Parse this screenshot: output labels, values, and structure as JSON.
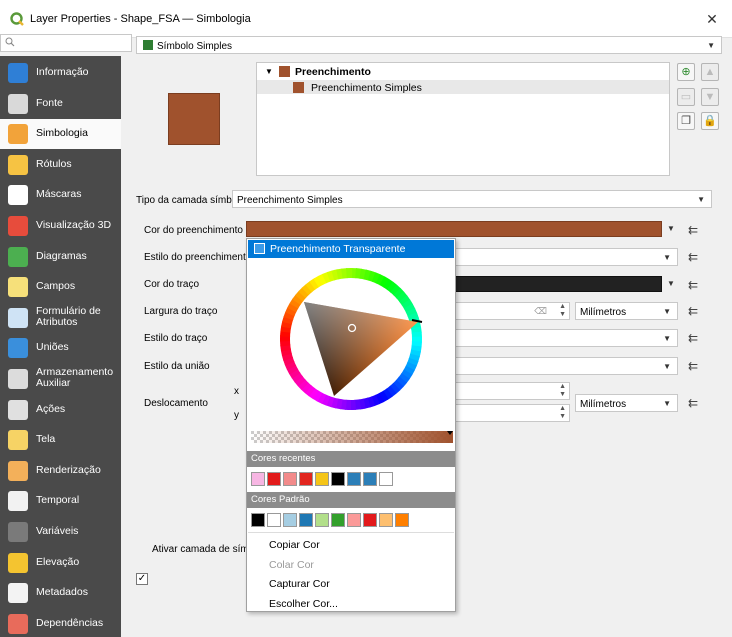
{
  "window": {
    "title": "Layer Properties - Shape_FSA — Simbologia",
    "close_glyph": "✕",
    "app_icon": "qgis-icon"
  },
  "search": {
    "placeholder": ""
  },
  "sidebar": {
    "items": [
      {
        "label": "Informação",
        "icon": "info-icon",
        "color": "#2f7fd6"
      },
      {
        "label": "Fonte",
        "icon": "source-icon",
        "color": "#d9d9d9"
      },
      {
        "label": "Simbologia",
        "icon": "symbology-icon",
        "color": "#f2a33a"
      },
      {
        "label": "Rótulos",
        "icon": "labels-icon",
        "color": "#f6c343"
      },
      {
        "label": "Máscaras",
        "icon": "masks-icon",
        "color": "#ffffff"
      },
      {
        "label": "Visualização 3D",
        "icon": "3d-view-icon",
        "color": "#e74c3c"
      },
      {
        "label": "Diagramas",
        "icon": "diagrams-icon",
        "color": "#4caf50"
      },
      {
        "label": "Campos",
        "icon": "fields-icon",
        "color": "#f6e07a"
      },
      {
        "label": "Formulário de Atributos",
        "icon": "attributes-form-icon",
        "color": "#cfe3f5"
      },
      {
        "label": "Uniões",
        "icon": "joins-icon",
        "color": "#3a8fdc"
      },
      {
        "label": "Armazenamento Auxiliar",
        "icon": "auxiliary-storage-icon",
        "color": "#dcdcdc"
      },
      {
        "label": "Ações",
        "icon": "actions-icon",
        "color": "#e0e0e0"
      },
      {
        "label": "Tela",
        "icon": "display-icon",
        "color": "#f6d365"
      },
      {
        "label": "Renderização",
        "icon": "rendering-icon",
        "color": "#f3b05a"
      },
      {
        "label": "Temporal",
        "icon": "temporal-icon",
        "color": "#f2f2f2"
      },
      {
        "label": "Variáveis",
        "icon": "variables-icon",
        "color": "#7a7a7a"
      },
      {
        "label": "Elevação",
        "icon": "elevation-icon",
        "color": "#f4c430"
      },
      {
        "label": "Metadados",
        "icon": "metadata-icon",
        "color": "#f3f3f3"
      },
      {
        "label": "Dependências",
        "icon": "dependencies-icon",
        "color": "#e86b5b"
      }
    ]
  },
  "symbol_selector": {
    "label": "Símbolo Simples"
  },
  "preview_color": "#a0522d",
  "layer_tree": {
    "root": "Preenchimento",
    "child": "Preenchimento Simples"
  },
  "symbol_layer_type": {
    "label": "Tipo da camada símbolo",
    "value": "Preenchimento Simples"
  },
  "properties": {
    "fill_color_label": "Cor do preenchimento",
    "fill_color": "#a0522d",
    "fill_style_label": "Estilo do preenchimento",
    "stroke_color_label": "Cor do traço",
    "stroke_color": "#222222",
    "stroke_width_label": "Largura do traço",
    "stroke_width_unit": "Milímetros",
    "stroke_style_label": "Estilo do traço",
    "join_style_label": "Estilo da união",
    "offset_label": "Deslocamento",
    "offset_x_label": "x",
    "offset_y_label": "y",
    "offset_unit": "Milímetros",
    "enable_layer_label": "Ativar camada de símbo",
    "checkbox_glyph": "✓"
  },
  "color_popup": {
    "transparent_label": "Preenchimento Transparente",
    "recent_header": "Cores recentes",
    "recent_colors": [
      "#f7b6e3",
      "#e21b1b",
      "#f28b8b",
      "#e2261f",
      "#f5c518",
      "#000000",
      "#2c7fb8",
      "#2c7fb8",
      "#ffffff"
    ],
    "standard_header": "Cores Padrão",
    "standard_colors": [
      "#000000",
      "#ffffff",
      "#a6cee3",
      "#1f78b4",
      "#b2df8a",
      "#33a02c",
      "#fb9a99",
      "#e31a1c",
      "#fdbf6f",
      "#ff7f00"
    ],
    "menu": [
      {
        "label": "Copiar Cor",
        "enabled": true
      },
      {
        "label": "Colar Cor",
        "enabled": false
      },
      {
        "label": "Capturar Cor",
        "enabled": true
      },
      {
        "label": "Escolher Cor...",
        "enabled": true
      }
    ]
  }
}
